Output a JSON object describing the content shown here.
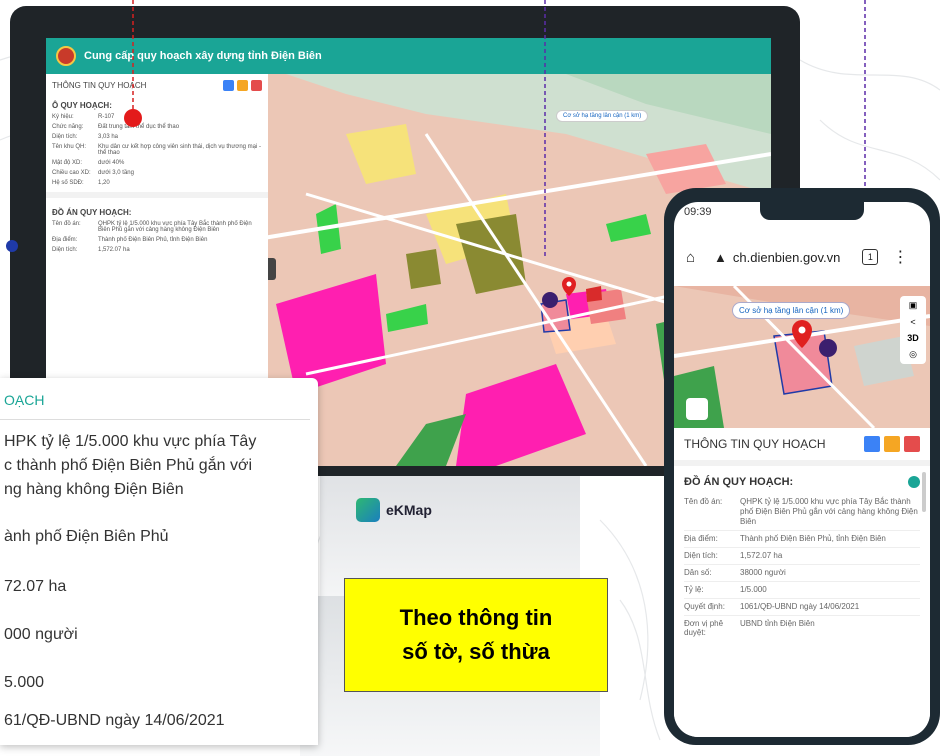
{
  "colors": {
    "teal": "#1aa596",
    "pink": "#ff1fb0",
    "green": "#38d24a",
    "olive": "#8a8a32",
    "blue": "#1f3aa8",
    "yellow": "#ffff00"
  },
  "desktop": {
    "app_title": "Cung cấp quy hoạch xây dựng tỉnh Điện Biên",
    "panel_title": "THÔNG TIN QUY HOẠCH",
    "section1": "Ô QUY HOẠCH:",
    "rows1": [
      {
        "k": "Ký hiệu:",
        "v": "R-107"
      },
      {
        "k": "Chức năng:",
        "v": "Đất trung tâm thể dục thể thao"
      },
      {
        "k": "Diện tích:",
        "v": "3,03 ha"
      },
      {
        "k": "Tên khu QH:",
        "v": "Khu dân cư kết hợp công viên sinh thái, dịch vụ thương mại - thể thao"
      },
      {
        "k": "Mật độ XD:",
        "v": "dưới 40%"
      },
      {
        "k": "Chiều cao XD:",
        "v": "dưới 3,0 tầng"
      },
      {
        "k": "Hệ số SDĐ:",
        "v": "1,20"
      }
    ],
    "section2": "ĐỒ ÁN QUY HOẠCH:",
    "rows2": [
      {
        "k": "Tên đồ án:",
        "v": "QHPK tỷ lệ 1/5.000 khu vực phía Tây Bắc thành phố Điện Biên Phủ gắn với cảng hàng không Điện Biên"
      },
      {
        "k": "Địa điểm:",
        "v": "Thành phố Điện Biên Phủ, tỉnh Điện Biên"
      },
      {
        "k": "Diện tích:",
        "v": "1,572.07 ha"
      }
    ],
    "map_tooltip": "Cơ sở hạ tầng lân cận (1 km)"
  },
  "brand": "eKMap",
  "detail_card": {
    "title": "OẠCH",
    "lines": [
      "HPK tỷ lệ 1/5.000 khu vực phía Tây",
      "c thành phố Điện Biên Phủ gắn với",
      "ng hàng không Điện Biên",
      "ành phố Điện Biên Phủ",
      "72.07 ha",
      "000 người",
      "5.000",
      "61/QĐ-UBND ngày 14/06/2021"
    ]
  },
  "note": {
    "line1": "Theo thông tin",
    "line2": "số tờ, số thừa"
  },
  "phone": {
    "time": "09:39",
    "url": "ch.dienbien.gov.vn",
    "tab_count": "1",
    "map_tooltip": "Cơ sở hạ tầng lân cận (1 km)",
    "tool_3d": "3D",
    "panel_title": "THÔNG TIN QUY HOẠCH",
    "section": "ĐỒ ÁN QUY HOẠCH:",
    "rows": [
      {
        "k": "Tên đồ án:",
        "v": "QHPK tỷ lệ 1/5.000 khu vực phía Tây Bắc thành phố Điện Biên Phủ gắn với cảng hàng không Điện Biên"
      },
      {
        "k": "Địa điểm:",
        "v": "Thành phố Điện Biên Phủ, tỉnh Điện Biên"
      },
      {
        "k": "Diện tích:",
        "v": "1,572.07 ha"
      },
      {
        "k": "Dân số:",
        "v": "38000 người"
      },
      {
        "k": "Tỷ lệ:",
        "v": "1/5.000"
      },
      {
        "k": "Quyết định:",
        "v": "1061/QĐ-UBND ngày 14/06/2021"
      },
      {
        "k": "Đơn vị phê duyệt:",
        "v": "UBND tỉnh Điện Biên"
      }
    ]
  }
}
